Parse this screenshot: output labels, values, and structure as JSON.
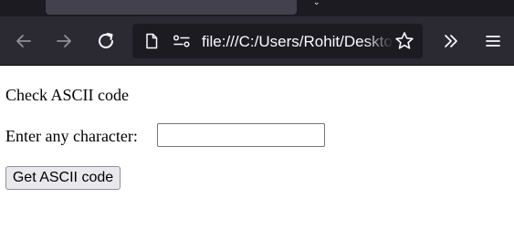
{
  "browser": {
    "url": "file:///C:/Users/Rohit/Desktop/ascii.html",
    "tab_strip_icon": "chevron-down-icon",
    "toolbar_icons": {
      "back": "arrow-left-icon",
      "forward": "arrow-right-icon",
      "reload": "reload-icon",
      "page": "page-icon",
      "permissions": "permissions-icon",
      "bookmark": "star-icon",
      "overflow": "double-chevron-right-icon",
      "menu": "hamburger-menu-icon"
    }
  },
  "page": {
    "heading": "Check ASCII code",
    "input_label": "Enter any character:",
    "input_value": "",
    "button_label": "Get ASCII code"
  },
  "colors": {
    "chrome_background": "#1c1b22",
    "toolbar_background": "#2b2a33",
    "icon_color": "#fbfbfe",
    "icon_disabled": "#8f8f9d",
    "button_background": "#e9e9ed"
  }
}
